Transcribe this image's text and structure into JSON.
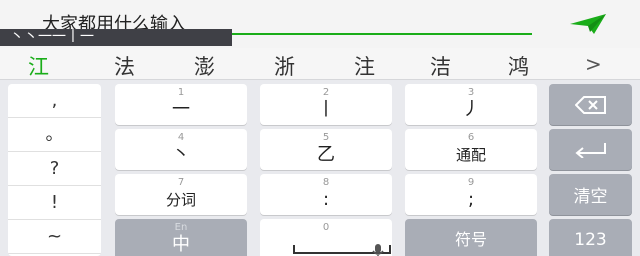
{
  "input": {
    "text": "大家都用什么输入",
    "stroke_preview": "丶丶一一丨一",
    "accent": "#1aad19"
  },
  "candidates": [
    "江",
    "法",
    "澎",
    "浙",
    "注",
    "洁",
    "鸿"
  ],
  "candidates_more": ">",
  "punctuation": [
    ",",
    "。",
    "?",
    "!",
    "~"
  ],
  "keys": {
    "k1": {
      "num": "1",
      "label": "一"
    },
    "k2": {
      "num": "2",
      "label": "丨"
    },
    "k3": {
      "num": "3",
      "label": "丿"
    },
    "k4": {
      "num": "4",
      "label": "丶"
    },
    "k5": {
      "num": "5",
      "label": "乙"
    },
    "k6": {
      "num": "6",
      "label": "通配"
    },
    "k7": {
      "num": "7",
      "label": "分词"
    },
    "k8": {
      "num": "8",
      "label": ":"
    },
    "k9": {
      "num": "9",
      "label": ";"
    },
    "lang": {
      "sub": "En",
      "label": "中"
    },
    "k0": {
      "num": "0"
    },
    "symbols": {
      "label": "符号"
    }
  },
  "fn_keys": {
    "clear": "清空",
    "numbers": "123"
  },
  "icons": {
    "send": "send-icon",
    "backspace": "backspace-icon",
    "enter": "enter-icon",
    "mic": "mic-icon"
  }
}
